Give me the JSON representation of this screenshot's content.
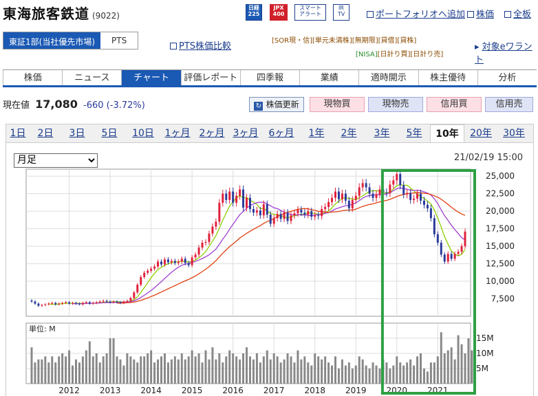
{
  "header": {
    "company": "東海旅客鉄道",
    "code": "(9022)",
    "badges": [
      {
        "line1": "日経",
        "line2": "225",
        "color": "#1a59b4"
      },
      {
        "line1": "JPX",
        "line2": "400",
        "color": "#d0202a"
      },
      {
        "line1": "スマート",
        "line2": "アラート",
        "color": "#ffffff"
      },
      {
        "line1": "IR",
        "line2": "TV",
        "color": "#ffffff"
      }
    ],
    "links": [
      "ポートフォリオへ追加",
      "株価",
      "全板"
    ]
  },
  "market": {
    "selected": "東証1部(当社優先市場)",
    "other": "PTS",
    "pts_compare": "PTS株価比較"
  },
  "tags": {
    "row1": [
      "[SOR現・信]",
      "[単元未満株]",
      "[無期限]",
      "[貸借]",
      "[貸株]"
    ],
    "row2": [
      "[NISA]",
      "[日計り買]",
      "[日計り売]"
    ],
    "warrant": "対象eワラント"
  },
  "tabs": [
    "株価",
    "ニュース",
    "チャート",
    "評価レポート",
    "四季報",
    "業績",
    "適時開示",
    "株主優待",
    "分析"
  ],
  "active_tab": "チャート",
  "price": {
    "label": "現在値",
    "value": "17,080",
    "change": "-660 (-3.72%)"
  },
  "actions": {
    "refresh": "株価更新",
    "buttons": [
      "現物買",
      "現物売",
      "信用買",
      "信用売"
    ]
  },
  "periods": [
    "1日",
    "2日",
    "3日",
    "5日",
    "10日",
    "1ヶ月",
    "2ヶ月",
    "3ヶ月",
    "6ヶ月",
    "1年",
    "2年",
    "3年",
    "5年",
    "10年",
    "20年",
    "30年"
  ],
  "active_period": "10年",
  "chart_controls": {
    "interval": "月足",
    "timestamp": "21/02/19 15:00",
    "volume_unit": "単位: M"
  },
  "chart_data": {
    "type": "candlestick",
    "x_ticks": [
      "2012",
      "2013",
      "2014",
      "2015",
      "2016",
      "2017",
      "2018",
      "2019",
      "2020",
      "2021"
    ],
    "y_ticks": [
      "25,000",
      "22,500",
      "20,000",
      "17,500",
      "15,000",
      "12,500",
      "10,000",
      "7,500"
    ],
    "ylim": [
      5000,
      26000
    ],
    "volume_ticks": [
      "15M",
      "10M",
      "5M"
    ],
    "volume_ylim": [
      0,
      20
    ],
    "colors": {
      "up": "#e0203a",
      "down": "#2a3a9a",
      "ma_short": "#8bd000",
      "ma_mid": "#a040d0",
      "ma_long": "#e04010",
      "volume": "#888888",
      "highlight": "#2ea043"
    },
    "closes": [
      7100,
      6800,
      6500,
      6600,
      6700,
      6800,
      6900,
      6700,
      6800,
      6900,
      7000,
      6800,
      6900,
      6800,
      6700,
      6900,
      7000,
      6800,
      6900,
      7000,
      7100,
      7200,
      7100,
      7000,
      7100,
      7000,
      6900,
      7100,
      7200,
      7600,
      8400,
      9500,
      10600,
      11200,
      11500,
      11800,
      12100,
      12800,
      12400,
      13100,
      12700,
      12900,
      12600,
      12800,
      13200,
      12600,
      12300,
      13400,
      13800,
      14800,
      15500,
      15600,
      16800,
      17800,
      18500,
      21200,
      22500,
      21600,
      22800,
      21200,
      22200,
      23100,
      20500,
      21900,
      20300,
      19800,
      20100,
      19400,
      21000,
      19500,
      18200,
      19000,
      19600,
      18900,
      19800,
      18600,
      19400,
      19700,
      20200,
      19800,
      19500,
      20000,
      19200,
      19400,
      19300,
      20300,
      20600,
      21300,
      21900,
      22800,
      21700,
      22500,
      21500,
      20400,
      21600,
      22200,
      23400,
      24000,
      23400,
      22500,
      21900,
      22400,
      23100,
      22700,
      22600,
      23800,
      24400,
      25300,
      23700,
      22400,
      22600,
      21600,
      21800,
      22500,
      21500,
      20900,
      20400,
      19000,
      16700,
      15500,
      13800,
      12800,
      13900,
      13200,
      13900,
      14200,
      15000,
      17080
    ]
  },
  "volume_data": [
    12,
    7,
    8,
    8,
    9,
    7,
    9,
    7,
    9,
    10,
    9,
    11,
    6,
    8,
    7,
    9,
    11,
    14,
    9,
    10,
    7,
    9,
    10,
    15,
    15,
    9,
    8,
    6,
    10,
    9,
    8,
    7,
    9,
    9,
    10,
    11,
    7,
    8,
    9,
    10,
    7,
    8,
    9,
    8,
    10,
    8,
    9,
    11,
    9,
    10,
    7,
    11,
    8,
    12,
    8,
    10,
    7,
    9,
    11,
    10,
    9,
    8,
    10,
    12,
    9,
    8,
    10,
    7,
    9,
    11,
    8,
    10,
    9,
    7,
    8,
    10,
    9,
    7,
    11,
    8,
    9,
    7,
    6,
    10,
    9,
    8,
    9,
    7,
    6,
    9,
    5,
    8,
    6,
    7,
    5,
    6,
    9,
    8,
    6,
    5,
    7,
    6,
    5,
    8,
    7,
    5,
    6,
    9,
    7,
    6,
    7,
    8,
    6,
    9,
    10,
    5,
    4,
    7,
    7,
    9,
    17,
    10,
    11,
    12,
    8,
    16,
    13,
    10,
    15,
    11
  ]
}
